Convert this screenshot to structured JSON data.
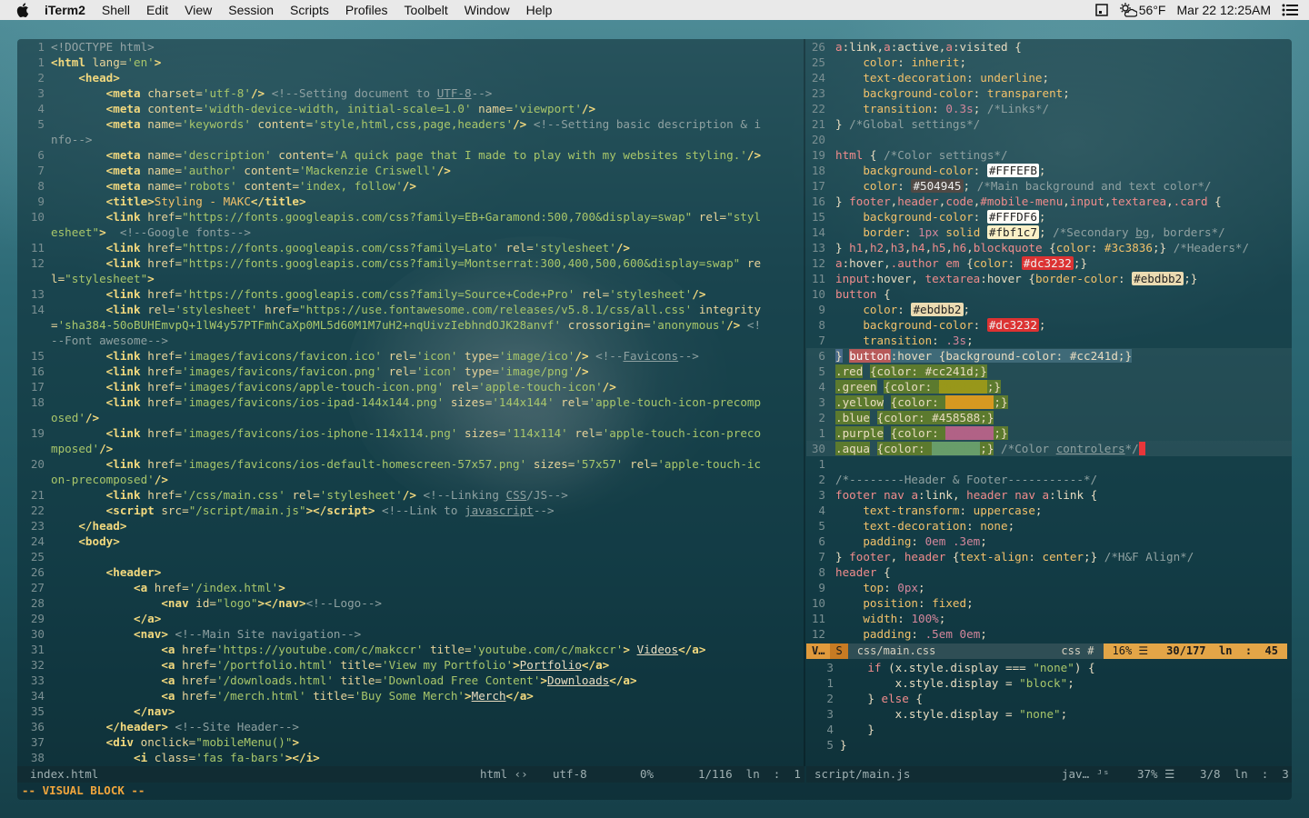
{
  "menubar": {
    "app": "iTerm2",
    "items": [
      "Shell",
      "Edit",
      "View",
      "Session",
      "Scripts",
      "Profiles",
      "Toolbelt",
      "Window",
      "Help"
    ],
    "weather": "56°F",
    "datetime": "Mar 22 12:25AM"
  },
  "left_pane": {
    "lines": [
      {
        "n": "1",
        "html": "<span class='pi'>&lt;!DOCTYPE html&gt;</span>"
      },
      {
        "n": "1",
        "html": "<span class='tg'>&lt;html</span> <span class='at'>lang=</span><span class='st'>'en'</span><span class='tg'>&gt;</span>"
      },
      {
        "n": "2",
        "html": "    <span class='tg'>&lt;head&gt;</span>"
      },
      {
        "n": "3",
        "html": "        <span class='tg'>&lt;meta</span> <span class='at'>charset=</span><span class='st'>'utf-8'</span><span class='tg'>/&gt;</span> <span class='cm'>&lt;!--Setting document to <u>UTF-8</u>--&gt;</span>"
      },
      {
        "n": "4",
        "html": "        <span class='tg'>&lt;meta</span> <span class='at'>content=</span><span class='st'>'width-device-width, initial-scale=1.0'</span> <span class='at'>name=</span><span class='st'>'viewport'</span><span class='tg'>/&gt;</span>"
      },
      {
        "n": "5",
        "html": "        <span class='tg'>&lt;meta</span> <span class='at'>name=</span><span class='st'>'keywords'</span> <span class='at'>content=</span><span class='st'>'style,html,css,page,headers'</span><span class='tg'>/&gt;</span> <span class='cm'>&lt;!--Setting basic description &amp; i</span>"
      },
      {
        "n": "",
        "html": "<span class='cm'>nfo--&gt;</span>"
      },
      {
        "n": "6",
        "html": "        <span class='tg'>&lt;meta</span> <span class='at'>name=</span><span class='st'>'description'</span> <span class='at'>content=</span><span class='st'>'A quick page that I made to play with my websites styling.'</span><span class='tg'>/&gt;</span>"
      },
      {
        "n": "7",
        "html": "        <span class='tg'>&lt;meta</span> <span class='at'>name=</span><span class='st'>'author'</span> <span class='at'>content=</span><span class='st'>'Mackenzie Criswell'</span><span class='tg'>/&gt;</span>"
      },
      {
        "n": "8",
        "html": "        <span class='tg'>&lt;meta</span> <span class='at'>name=</span><span class='st'>'robots'</span> <span class='at'>content=</span><span class='st'>'index, follow'</span><span class='tg'>/&gt;</span>"
      },
      {
        "n": "9",
        "html": "        <span class='tg'>&lt;title&gt;</span><span class='pr'>Styling - MAKC</span><span class='tg'>&lt;/title&gt;</span>"
      },
      {
        "n": "10",
        "html": "        <span class='tg'>&lt;link</span> <span class='at'>href=</span><span class='st'>\"https://fonts.googleapis.com/css?family=EB+Garamond:500,700&amp;display=swap\"</span> <span class='at'>rel=</span><span class='st'>\"styl</span>"
      },
      {
        "n": "",
        "html": "<span class='st'>esheet\"</span><span class='tg'>&gt;</span>  <span class='cm'>&lt;!--Google fonts--&gt;</span>"
      },
      {
        "n": "11",
        "html": "        <span class='tg'>&lt;link</span> <span class='at'>href=</span><span class='st'>\"https://fonts.googleapis.com/css?family=Lato'</span> <span class='at'>rel=</span><span class='st'>'stylesheet'</span><span class='tg'>/&gt;</span>"
      },
      {
        "n": "12",
        "html": "        <span class='tg'>&lt;link</span> <span class='at'>href=</span><span class='st'>\"https://fonts.googleapis.com/css?family=Montserrat:300,400,500,600&amp;display=swap\"</span> <span class='at'>re</span>"
      },
      {
        "n": "",
        "html": "<span class='at'>l=</span><span class='st'>\"stylesheet\"</span><span class='tg'>&gt;</span>"
      },
      {
        "n": "13",
        "html": "        <span class='tg'>&lt;link</span> <span class='at'>href=</span><span class='st'>'https://fonts.googleapis.com/css?family=Source+Code+Pro'</span> <span class='at'>rel=</span><span class='st'>'stylesheet'</span><span class='tg'>/&gt;</span>"
      },
      {
        "n": "14",
        "html": "        <span class='tg'>&lt;link</span> <span class='at'>rel=</span><span class='st'>'stylesheet'</span> <span class='at'>href=</span><span class='st'>\"https://use.fontawesome.com/releases/v5.8.1/css/all.css'</span> <span class='at'>integrity</span>"
      },
      {
        "n": "",
        "html": "<span class='at'>=</span><span class='st'>'sha384-50oBUHEmvpQ+1lW4y57PTFmhCaXp0ML5d60M1M7uH2+nqUivzIebhndOJK28anvf'</span> <span class='at'>crossorigin=</span><span class='st'>'anonymous'</span><span class='tg'>/&gt;</span> <span class='cm'>&lt;!</span>"
      },
      {
        "n": "",
        "html": "<span class='cm'>--Font awesome--&gt;</span>"
      },
      {
        "n": "15",
        "html": "        <span class='tg'>&lt;link</span> <span class='at'>href=</span><span class='st'>'images/favicons/favicon.ico'</span> <span class='at'>rel=</span><span class='st'>'icon'</span> <span class='at'>type=</span><span class='st'>'image/ico'</span><span class='tg'>/&gt;</span> <span class='cm'>&lt;!--<u>Favicons</u>--&gt;</span>"
      },
      {
        "n": "16",
        "html": "        <span class='tg'>&lt;link</span> <span class='at'>href=</span><span class='st'>'images/favicons/favicon.png'</span> <span class='at'>rel=</span><span class='st'>'icon'</span> <span class='at'>type=</span><span class='st'>'image/png'</span><span class='tg'>/&gt;</span>"
      },
      {
        "n": "17",
        "html": "        <span class='tg'>&lt;link</span> <span class='at'>href=</span><span class='st'>'images/favicons/apple-touch-icon.png'</span> <span class='at'>rel=</span><span class='st'>'apple-touch-icon'</span><span class='tg'>/&gt;</span>"
      },
      {
        "n": "18",
        "html": "        <span class='tg'>&lt;link</span> <span class='at'>href=</span><span class='st'>'images/favicons/ios-ipad-144x144.png'</span> <span class='at'>sizes=</span><span class='st'>'144x144'</span> <span class='at'>rel=</span><span class='st'>'apple-touch-icon-precomp</span>"
      },
      {
        "n": "",
        "html": "<span class='st'>osed'</span><span class='tg'>/&gt;</span>"
      },
      {
        "n": "19",
        "html": "        <span class='tg'>&lt;link</span> <span class='at'>href=</span><span class='st'>'images/favicons/ios-iphone-114x114.png'</span> <span class='at'>sizes=</span><span class='st'>'114x114'</span> <span class='at'>rel=</span><span class='st'>'apple-touch-icon-preco</span>"
      },
      {
        "n": "",
        "html": "<span class='st'>mposed'</span><span class='tg'>/&gt;</span>"
      },
      {
        "n": "20",
        "html": "        <span class='tg'>&lt;link</span> <span class='at'>href=</span><span class='st'>'images/favicons/ios-default-homescreen-57x57.png'</span> <span class='at'>sizes=</span><span class='st'>'57x57'</span> <span class='at'>rel=</span><span class='st'>'apple-touch-ic</span>"
      },
      {
        "n": "",
        "html": "<span class='st'>on-precomposed'</span><span class='tg'>/&gt;</span>"
      },
      {
        "n": "21",
        "html": "        <span class='tg'>&lt;link</span> <span class='at'>href=</span><span class='st'>'/css/main.css'</span> <span class='at'>rel=</span><span class='st'>'stylesheet'</span><span class='tg'>/&gt;</span> <span class='cm'>&lt;!--Linking <u>CSS</u>/JS--&gt;</span>"
      },
      {
        "n": "22",
        "html": "        <span class='tg'>&lt;script</span> <span class='at'>src=</span><span class='st'>\"/script/main.js\"</span><span class='tg'>&gt;&lt;/script&gt;</span> <span class='cm'>&lt;!--Link to <u>javascript</u>--&gt;</span>"
      },
      {
        "n": "23",
        "html": "    <span class='tg'>&lt;/head&gt;</span>"
      },
      {
        "n": "24",
        "html": "    <span class='tg'>&lt;body&gt;</span>"
      },
      {
        "n": "25",
        "html": ""
      },
      {
        "n": "26",
        "html": "        <span class='tg'>&lt;header&gt;</span>"
      },
      {
        "n": "27",
        "html": "            <span class='tg'>&lt;a</span> <span class='at'>href=</span><span class='st'>'/index.html'</span><span class='tg'>&gt;</span>"
      },
      {
        "n": "28",
        "html": "                <span class='tg'>&lt;nav</span> <span class='at'>id=</span><span class='st'>\"logo\"</span><span class='tg'>&gt;&lt;/nav&gt;</span><span class='cm'>&lt;!--Logo--&gt;</span>"
      },
      {
        "n": "29",
        "html": "            <span class='tg'>&lt;/a&gt;</span>"
      },
      {
        "n": "30",
        "html": "            <span class='tg'>&lt;nav&gt;</span> <span class='cm'>&lt;!--Main Site navigation--&gt;</span>"
      },
      {
        "n": "31",
        "html": "                <span class='tg'>&lt;a</span> <span class='at'>href=</span><span class='st'>'https://youtube.com/c/makccr'</span> <span class='at'>title=</span><span class='st'>'youtube.com/c/makccr'</span><span class='tg'>&gt;</span> <u>Videos</u><span class='tg'>&lt;/a&gt;</span>"
      },
      {
        "n": "32",
        "html": "                <span class='tg'>&lt;a</span> <span class='at'>href=</span><span class='st'>'/portfolio.html'</span> <span class='at'>title=</span><span class='st'>'View my Portfolio'</span><span class='tg'>&gt;</span><u>Portfolio</u><span class='tg'>&lt;/a&gt;</span>"
      },
      {
        "n": "33",
        "html": "                <span class='tg'>&lt;a</span> <span class='at'>href=</span><span class='st'>'/downloads.html'</span> <span class='at'>title=</span><span class='st'>'Download Free Content'</span><span class='tg'>&gt;</span><u>Downloads</u><span class='tg'>&lt;/a&gt;</span>"
      },
      {
        "n": "34",
        "html": "                <span class='tg'>&lt;a</span> <span class='at'>href=</span><span class='st'>'/merch.html'</span> <span class='at'>title=</span><span class='st'>'Buy Some Merch'</span><span class='tg'>&gt;</span><u>Merch</u><span class='tg'>&lt;/a&gt;</span>"
      },
      {
        "n": "35",
        "html": "            <span class='tg'>&lt;/nav&gt;</span>"
      },
      {
        "n": "36",
        "html": "        <span class='tg'>&lt;/header&gt;</span> <span class='cm'>&lt;!--Site Header--&gt;</span>"
      },
      {
        "n": "37",
        "html": "        <span class='tg'>&lt;div</span> <span class='at'>onclick=</span><span class='st'>\"mobileMenu()\"</span><span class='tg'>&gt;</span>"
      },
      {
        "n": "38",
        "html": "            <span class='tg'>&lt;i</span> <span class='at'>class=</span><span class='st'>'fas fa-bars'</span><span class='tg'>&gt;&lt;/i&gt;</span>"
      }
    ],
    "status": {
      "file": "index.html",
      "type": "html ‹›",
      "enc": "utf-8",
      "pct": "0%",
      "pos": "1/116  ln  :  1"
    }
  },
  "right_pane": {
    "lines": [
      {
        "n": "26",
        "html": "<span class='sel'>a</span>:link,<span class='sel'>a</span>:active,<span class='sel'>a</span>:visited {"
      },
      {
        "n": "25",
        "html": "    <span class='pr'>color</span>: <span class='vl'>inherit</span>;"
      },
      {
        "n": "24",
        "html": "    <span class='pr'>text-decoration</span>: <span class='vl'>underline</span>;"
      },
      {
        "n": "23",
        "html": "    <span class='pr'>background-color</span>: <span class='vl'>transparent</span>;"
      },
      {
        "n": "22",
        "html": "    <span class='pr'>transition</span>: <span class='num'>0.3s</span>; <span class='cm'>/*Links*/</span>"
      },
      {
        "n": "21",
        "html": "} <span class='cm'>/*Global settings*/</span>"
      },
      {
        "n": "20",
        "html": ""
      },
      {
        "n": "19",
        "html": "<span class='sel'>html</span> { <span class='cm'>/*Color settings*/</span>"
      },
      {
        "n": "18",
        "html": "    <span class='pr'>background-color</span>: <span class='sw' style='background:#FFFEFB;color:#222'>#FFFEFB</span>;"
      },
      {
        "n": "17",
        "html": "    <span class='pr'>color</span>: <span class='sw' style='background:#504945;color:#eee'>#504945</span>; <span class='cm'>/*Main background and text color*/</span>"
      },
      {
        "n": "16",
        "html": "} <span class='sel'>footer</span>,<span class='sel'>header</span>,<span class='sel'>code</span>,<span class='sel'>#mobile-menu</span>,<span class='sel'>input</span>,<span class='sel'>textarea</span>,<span class='sel'>.card</span> {"
      },
      {
        "n": "15",
        "html": "    <span class='pr'>background-color</span>: <span class='sw' style='background:#FFFDF6;color:#222'>#FFFDF6</span>;"
      },
      {
        "n": "14",
        "html": "    <span class='pr'>border</span>: <span class='num'>1px</span> <span class='vl'>solid</span> <span class='sw' style='background:#fbf1c7;color:#222'>#fbf1c7</span>; <span class='cm'>/*Secondary <u>bg</u>, borders*/</span>"
      },
      {
        "n": "13",
        "html": "} <span class='sel'>h1</span>,<span class='sel'>h2</span>,<span class='sel'>h3</span>,<span class='sel'>h4</span>,<span class='sel'>h5</span>,<span class='sel'>h6</span>,<span class='sel'>blockquote</span> {<span class='pr'>color</span>: <span class='vl'>#3c3836</span>;} <span class='cm'>/*Headers*/</span>"
      },
      {
        "n": "12",
        "html": "<span class='sel'>a</span>:hover,<span class='sel'>.author</span> <span class='sel'>em</span> {<span class='pr'>color</span>: <span class='sw' style='background:#dc3232;color:#eee'>#dc3232</span>;}"
      },
      {
        "n": "11",
        "html": "<span class='sel'>input</span>:hover, <span class='sel'>textarea</span>:hover {<span class='pr'>border-color</span>: <span class='sw' style='background:#ebdbb2;color:#222'>#ebdbb2</span>;}"
      },
      {
        "n": "10",
        "html": "<span class='sel'>button</span> {"
      },
      {
        "n": "9",
        "html": "    <span class='pr'>color</span>: <span class='sw' style='background:#ebdbb2;color:#222'>#ebdbb2</span>;"
      },
      {
        "n": "8",
        "html": "    <span class='pr'>background-color</span>: <span class='sw' style='background:#dc3232;color:#eee'>#dc3232</span>;"
      },
      {
        "n": "7",
        "html": "    <span class='pr'>transition</span>: <span class='num'>.3s</span>;"
      },
      {
        "n": "6",
        "html": "<span style='background:#4a6b8a'>}</span> <span style='background:#b85a5a;color:#fff'>button</span><span style='background:#3f6a78'>:hover {background-color: #cc241d;}</span>",
        "sel": true
      },
      {
        "n": "5",
        "html": "<span class='hlgreen'>.red</span> <span class='hlgreen'>{color: #cc241d;}</span>",
        "sel": true
      },
      {
        "n": "4",
        "html": "<span class='hlgreen'>.green</span> <span class='hlgreen'>{color: </span><span style='background:#98971a;color:#98971a'>#98971a</span><span class='hlgreen'>;}</span>",
        "sel": true
      },
      {
        "n": "3",
        "html": "<span class='hlgreen'>.yellow</span> <span class='hlgreen'>{color: </span><span style='background:#d79921;color:#d79921'>#d79921</span><span class='hlgreen'>;}</span>",
        "sel": true
      },
      {
        "n": "2",
        "html": "<span class='hlgreen'>.blue</span> <span class='hlgreen'>{color: #458588;}</span>",
        "sel": true
      },
      {
        "n": "1",
        "html": "<span class='hlgreen'>.purple</span> <span class='hlgreen'>{color: </span><span style='background:#b16286;color:#b16286'>#b16286</span><span class='hlgreen'>;}</span>",
        "sel": true
      },
      {
        "n": "30",
        "html": "<span class='hlgreen'>.aqua</span> <span class='hlgreen'>{color: </span><span style='background:#689d6a;color:#689d6a'>#689d6a</span><span class='hlgreen'>;}</span> <span class='cm'>/*Color <u>controlers</u>*/</span><span class='cur'></span>",
        "cursor": true
      },
      {
        "n": "1",
        "html": ""
      },
      {
        "n": "2",
        "html": "<span class='cm'>/*--------Header &amp; Footer-----------*/</span>"
      },
      {
        "n": "3",
        "html": "<span class='sel'>footer</span> <span class='sel'>nav</span> <span class='sel'>a</span>:link, <span class='sel'>header</span> <span class='sel'>nav</span> <span class='sel'>a</span>:link {"
      },
      {
        "n": "4",
        "html": "    <span class='pr'>text-transform</span>: <span class='vl'>uppercase</span>;"
      },
      {
        "n": "5",
        "html": "    <span class='pr'>text-decoration</span>: <span class='vl'>none</span>;"
      },
      {
        "n": "6",
        "html": "    <span class='pr'>padding</span>: <span class='num'>0em</span> <span class='num'>.3em</span>;"
      },
      {
        "n": "7",
        "html": "} <span class='sel'>footer</span>, <span class='sel'>header</span> {<span class='pr'>text-align</span>: <span class='vl'>center</span>;} <span class='cm'>/*H&amp;F Align*/</span>"
      },
      {
        "n": "8",
        "html": "<span class='sel'>header</span> {"
      },
      {
        "n": "9",
        "html": "    <span class='pr'>top</span>: <span class='num'>0px</span>;"
      },
      {
        "n": "10",
        "html": "    <span class='pr'>position</span>: <span class='vl'>fixed</span>;"
      },
      {
        "n": "11",
        "html": "    <span class='pr'>width</span>: <span class='num'>100%</span>;"
      },
      {
        "n": "12",
        "html": "    <span class='pr'>padding</span>: <span class='num'>.5em</span> <span class='num'>0em</span>;"
      }
    ],
    "statusbar": {
      "mode": "V…",
      "s": "S",
      "file": "css/main.css",
      "type": "css #",
      "pct": "16% ☰",
      "pos": "30/177  ln  :  45"
    },
    "mini_lines": [
      {
        "n": "3",
        "html": "    <span class='kw'>if</span> (x.style.display === <span class='st'>\"none\"</span>) {"
      },
      {
        "n": "1",
        "html": "        x.style.display = <span class='st'>\"block\"</span>;"
      },
      {
        "n": "2",
        "html": "    } <span class='kw'>else</span> {"
      },
      {
        "n": "3",
        "html": "        x.style.display = <span class='st'>\"none\"</span>;"
      },
      {
        "n": "4",
        "html": "    }"
      },
      {
        "n": "5",
        "html": "}"
      }
    ],
    "status": {
      "file": "script/main.js",
      "type": "jav… ᴶˢ",
      "pct": "37% ☰",
      "pos": "3/8  ln  :  3"
    }
  },
  "mode_line": "-- VISUAL BLOCK --"
}
